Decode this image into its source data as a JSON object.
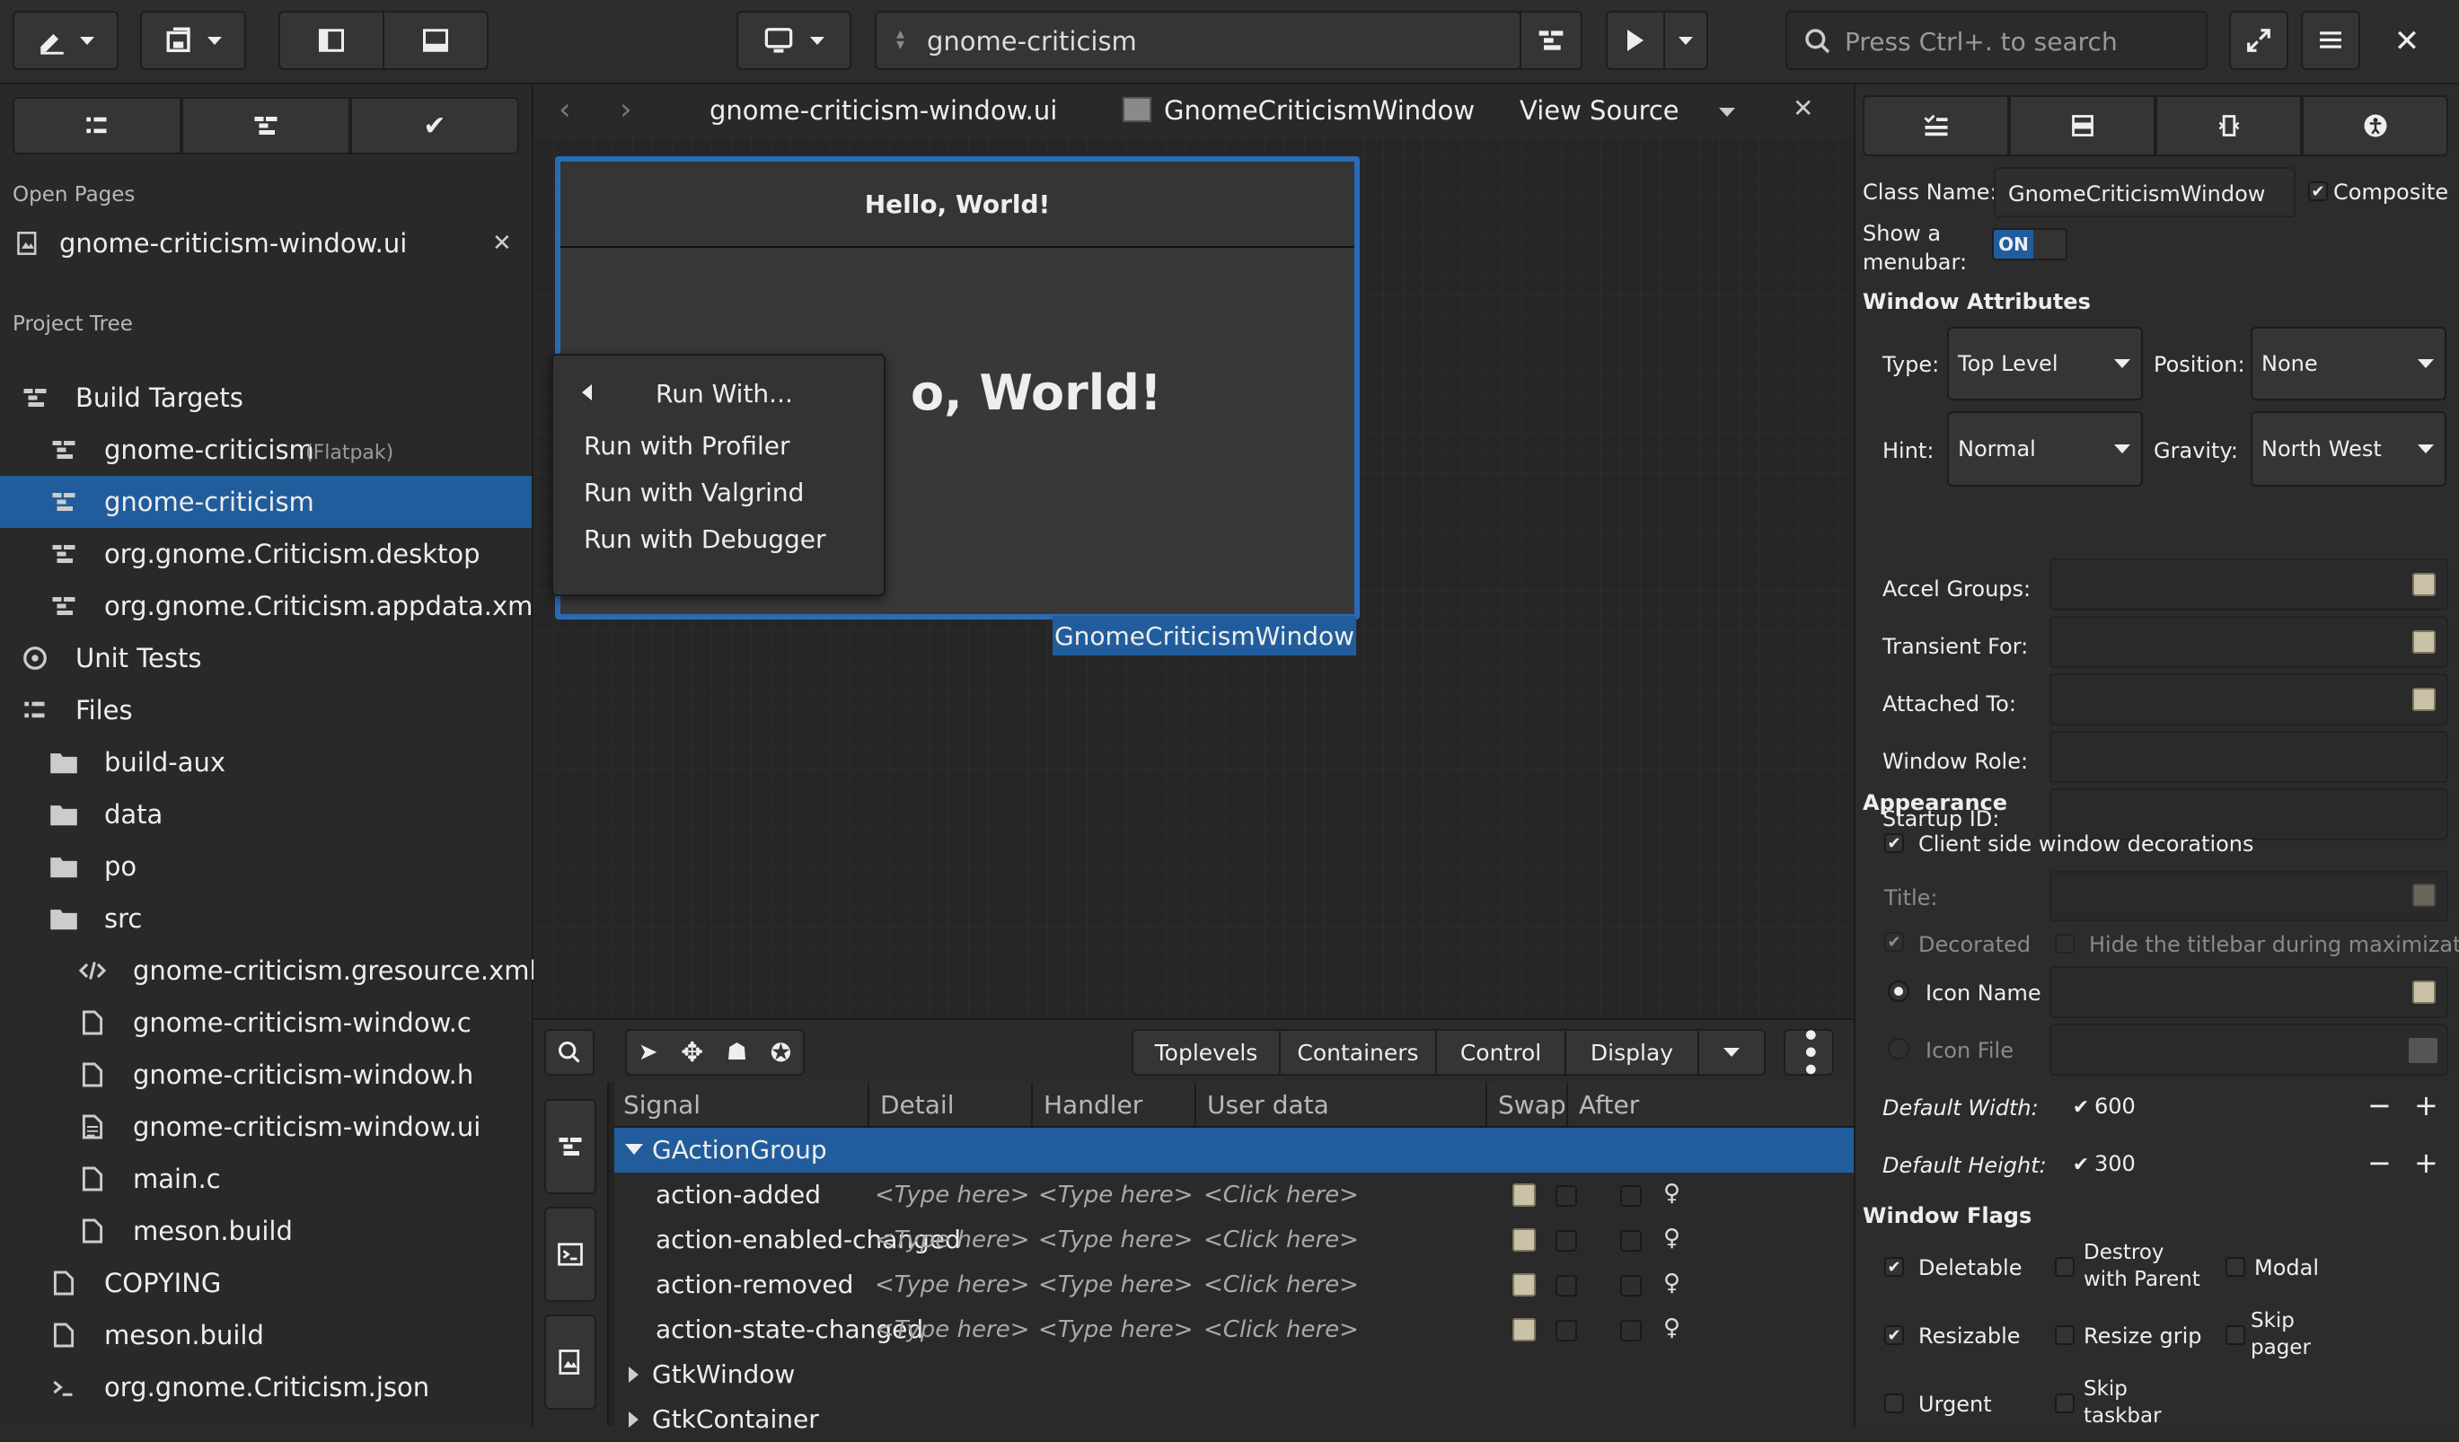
{
  "header": {
    "project": "gnome-criticism",
    "search_placeholder": "Press Ctrl+. to search"
  },
  "sidebar": {
    "open_pages_label": "Open Pages",
    "open_page": "gnome-criticism-window.ui",
    "project_tree_label": "Project Tree",
    "items": [
      {
        "label": "Build Targets",
        "suffix": ""
      },
      {
        "label": "gnome-criticism",
        "suffix": "(Flatpak)"
      },
      {
        "label": "gnome-criticism",
        "suffix": ""
      },
      {
        "label": "org.gnome.Criticism.desktop",
        "suffix": ""
      },
      {
        "label": "org.gnome.Criticism.appdata.xml",
        "suffix": ""
      },
      {
        "label": "Unit Tests",
        "suffix": ""
      },
      {
        "label": "Files",
        "suffix": ""
      },
      {
        "label": "build-aux",
        "suffix": ""
      },
      {
        "label": "data",
        "suffix": ""
      },
      {
        "label": "po",
        "suffix": ""
      },
      {
        "label": "src",
        "suffix": ""
      },
      {
        "label": "gnome-criticism.gresource.xml",
        "suffix": ""
      },
      {
        "label": "gnome-criticism-window.c",
        "suffix": ""
      },
      {
        "label": "gnome-criticism-window.h",
        "suffix": ""
      },
      {
        "label": "gnome-criticism-window.ui",
        "suffix": ""
      },
      {
        "label": "main.c",
        "suffix": ""
      },
      {
        "label": "meson.build",
        "suffix": ""
      },
      {
        "label": "COPYING",
        "suffix": ""
      },
      {
        "label": "meson.build",
        "suffix": ""
      },
      {
        "label": "org.gnome.Criticism.json",
        "suffix": ""
      }
    ]
  },
  "editor": {
    "file_tab": "gnome-criticism-window.ui",
    "class_tab": "GnomeCriticismWindow",
    "view_source": "View Source",
    "preview_title": "Hello, World!",
    "preview_label": "Hello, World!",
    "preview_label_visible": "o, World!",
    "selection_label": "GnomeCriticismWindow"
  },
  "popup": {
    "back_label": "Run With...",
    "items": [
      "Run with Profiler",
      "Run with Valgrind",
      "Run with Debugger"
    ]
  },
  "palette": {
    "tabs": [
      "Toplevels",
      "Containers",
      "Control",
      "Display"
    ]
  },
  "signals": {
    "columns": [
      "Signal",
      "Detail",
      "Handler",
      "User data",
      "Swap",
      "After"
    ],
    "group": "GActionGroup",
    "rows": [
      "action-added",
      "action-enabled-changed",
      "action-removed",
      "action-state-changed"
    ],
    "type_here": "<Type here>",
    "click_here": "<Click here>",
    "more_groups": [
      "GtkWindow",
      "GtkContainer"
    ]
  },
  "properties": {
    "class_name_label": "Class Name:",
    "class_name": "GnomeCriticismWindow",
    "composite_label": "Composite",
    "menubar_label_1": "Show a",
    "menubar_label_2": "menubar:",
    "toggle_on": "ON",
    "window_attributes": "Window Attributes",
    "type_label": "Type:",
    "type_value": "Top Level",
    "position_label": "Position:",
    "position_value": "None",
    "hint_label": "Hint:",
    "hint_value": "Normal",
    "gravity_label": "Gravity:",
    "gravity_value": "North West",
    "accel_groups": "Accel Groups:",
    "transient_for": "Transient For:",
    "attached_to": "Attached To:",
    "window_role": "Window Role:",
    "startup_id": "Startup ID:",
    "appearance": "Appearance",
    "csd": "Client side window decorations",
    "title_label": "Title:",
    "decorated": "Decorated",
    "hide_titlebar": "Hide the titlebar during maximization",
    "icon_name": "Icon Name",
    "icon_file": "Icon File",
    "default_width_label": "Default Width:",
    "default_width": "600",
    "default_height_label": "Default Height:",
    "default_height": "300",
    "window_flags": "Window Flags",
    "deletable": "Deletable",
    "destroy_1": "Destroy",
    "destroy_2": "with Parent",
    "modal": "Modal",
    "resizable": "Resizable",
    "resize_grip": "Resize grip",
    "skip_pager_1": "Skip",
    "skip_pager_2": "pager",
    "urgent": "Urgent",
    "skip_taskbar_1": "Skip",
    "skip_taskbar_2": "taskbar"
  },
  "colors": {
    "accent": "#215d9c",
    "background": "#2a2a2a"
  }
}
